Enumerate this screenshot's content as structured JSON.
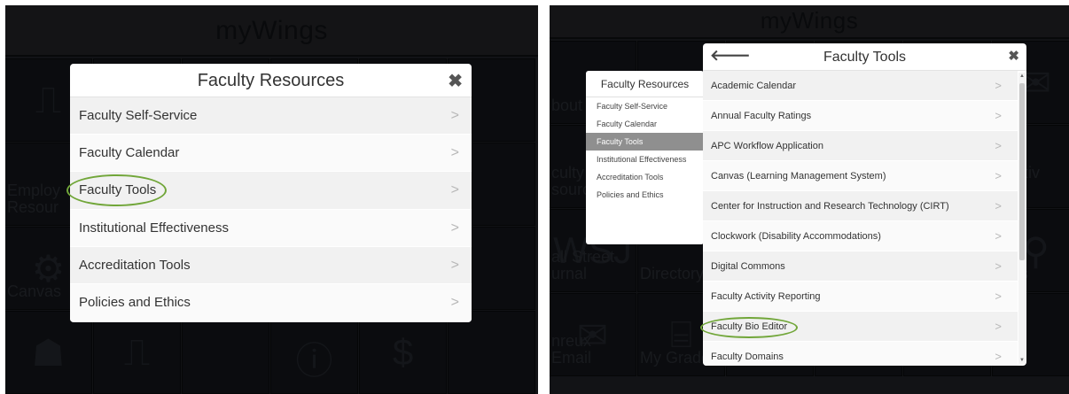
{
  "left": {
    "header": {
      "title": "myWings"
    },
    "tiles": [
      {
        "label": "",
        "icon": "⎍"
      },
      {
        "label": "",
        "icon": ""
      },
      {
        "label": "",
        "icon": ""
      },
      {
        "label": "",
        "icon": ""
      },
      {
        "label": "",
        "icon": "▦"
      },
      {
        "label": "",
        "icon": ""
      },
      {
        "label": "Employ\nResour",
        "icon": ""
      },
      {
        "label": "",
        "icon": ""
      },
      {
        "label": "",
        "icon": ""
      },
      {
        "label": "",
        "icon": ""
      },
      {
        "label": "ws",
        "icon": ""
      },
      {
        "label": "",
        "icon": ""
      },
      {
        "label": "Canvas",
        "icon": "⚙"
      },
      {
        "label": "",
        "icon": ""
      },
      {
        "label": "",
        "icon": ""
      },
      {
        "label": "",
        "icon": ""
      },
      {
        "label": "",
        "icon": "▮"
      },
      {
        "label": "",
        "icon": ""
      },
      {
        "label": "",
        "icon": "☗"
      },
      {
        "label": "",
        "icon": "⎍"
      },
      {
        "label": "",
        "icon": ""
      },
      {
        "label": "",
        "icon": "ⓘ"
      },
      {
        "label": "",
        "icon": "$"
      },
      {
        "label": "",
        "icon": ""
      }
    ],
    "modal": {
      "title": "Faculty Resources",
      "close": "✖",
      "items": [
        {
          "label": "Faculty Self-Service"
        },
        {
          "label": "Faculty Calendar"
        },
        {
          "label": "Faculty Tools"
        },
        {
          "label": "Institutional Effectiveness"
        },
        {
          "label": "Accreditation Tools"
        },
        {
          "label": "Policies and Ethics"
        }
      ],
      "chevron": ">"
    }
  },
  "right": {
    "header": {
      "title": "myWings"
    },
    "tiles": [
      {
        "label": "bout U",
        "icon": ""
      },
      {
        "label": "",
        "icon": ""
      },
      {
        "label": "",
        "icon": ""
      },
      {
        "label": "",
        "icon": ""
      },
      {
        "label": "",
        "icon": ""
      },
      {
        "label": "",
        "icon": "✉"
      },
      {
        "label": "culty\nsource",
        "icon": ""
      },
      {
        "label": "",
        "icon": ""
      },
      {
        "label": "",
        "icon": ""
      },
      {
        "label": "",
        "icon": ""
      },
      {
        "label": "",
        "icon": ""
      },
      {
        "label": "NB\nt Nativ\nnner",
        "icon": ""
      },
      {
        "label": "all Street\nurnal",
        "icon": "WSJ"
      },
      {
        "label": "Directory",
        "icon": ""
      },
      {
        "label": "",
        "icon": ""
      },
      {
        "label": "",
        "icon": ""
      },
      {
        "label": "",
        "icon": ""
      },
      {
        "label": "nd\ntions",
        "icon": "⚲"
      },
      {
        "label": "nreux Email",
        "icon": "✉"
      },
      {
        "label": "My Grader",
        "icon": "⌸"
      },
      {
        "label": "",
        "icon": ""
      },
      {
        "label": "",
        "icon": ""
      },
      {
        "label": "",
        "icon": ""
      },
      {
        "label": "",
        "icon": ""
      }
    ],
    "side_menu": {
      "title": "Faculty Resources",
      "items": [
        {
          "label": "Faculty Self-Service",
          "active": false
        },
        {
          "label": "Faculty Calendar",
          "active": false
        },
        {
          "label": "Faculty Tools",
          "active": true
        },
        {
          "label": "Institutional Effectiveness",
          "active": false
        },
        {
          "label": "Accreditation Tools",
          "active": false
        },
        {
          "label": "Policies and Ethics",
          "active": false
        }
      ]
    },
    "modal": {
      "title": "Faculty Tools",
      "back": "🡐",
      "close": "✖",
      "items": [
        {
          "label": "Academic Calendar"
        },
        {
          "label": "Annual Faculty Ratings"
        },
        {
          "label": "APC Workflow Application"
        },
        {
          "label": "Canvas (Learning Management System)"
        },
        {
          "label": "Center for Instruction and Research Technology (CIRT)"
        },
        {
          "label": "Clockwork (Disability Accommodations)"
        },
        {
          "label": "Digital Commons"
        },
        {
          "label": "Faculty Activity Reporting"
        },
        {
          "label": "Faculty Bio Editor"
        },
        {
          "label": "Faculty Domains"
        }
      ],
      "chevron": ">"
    }
  },
  "colors": {
    "highlight": "#71a639",
    "active_item": "#8f8f8f"
  }
}
